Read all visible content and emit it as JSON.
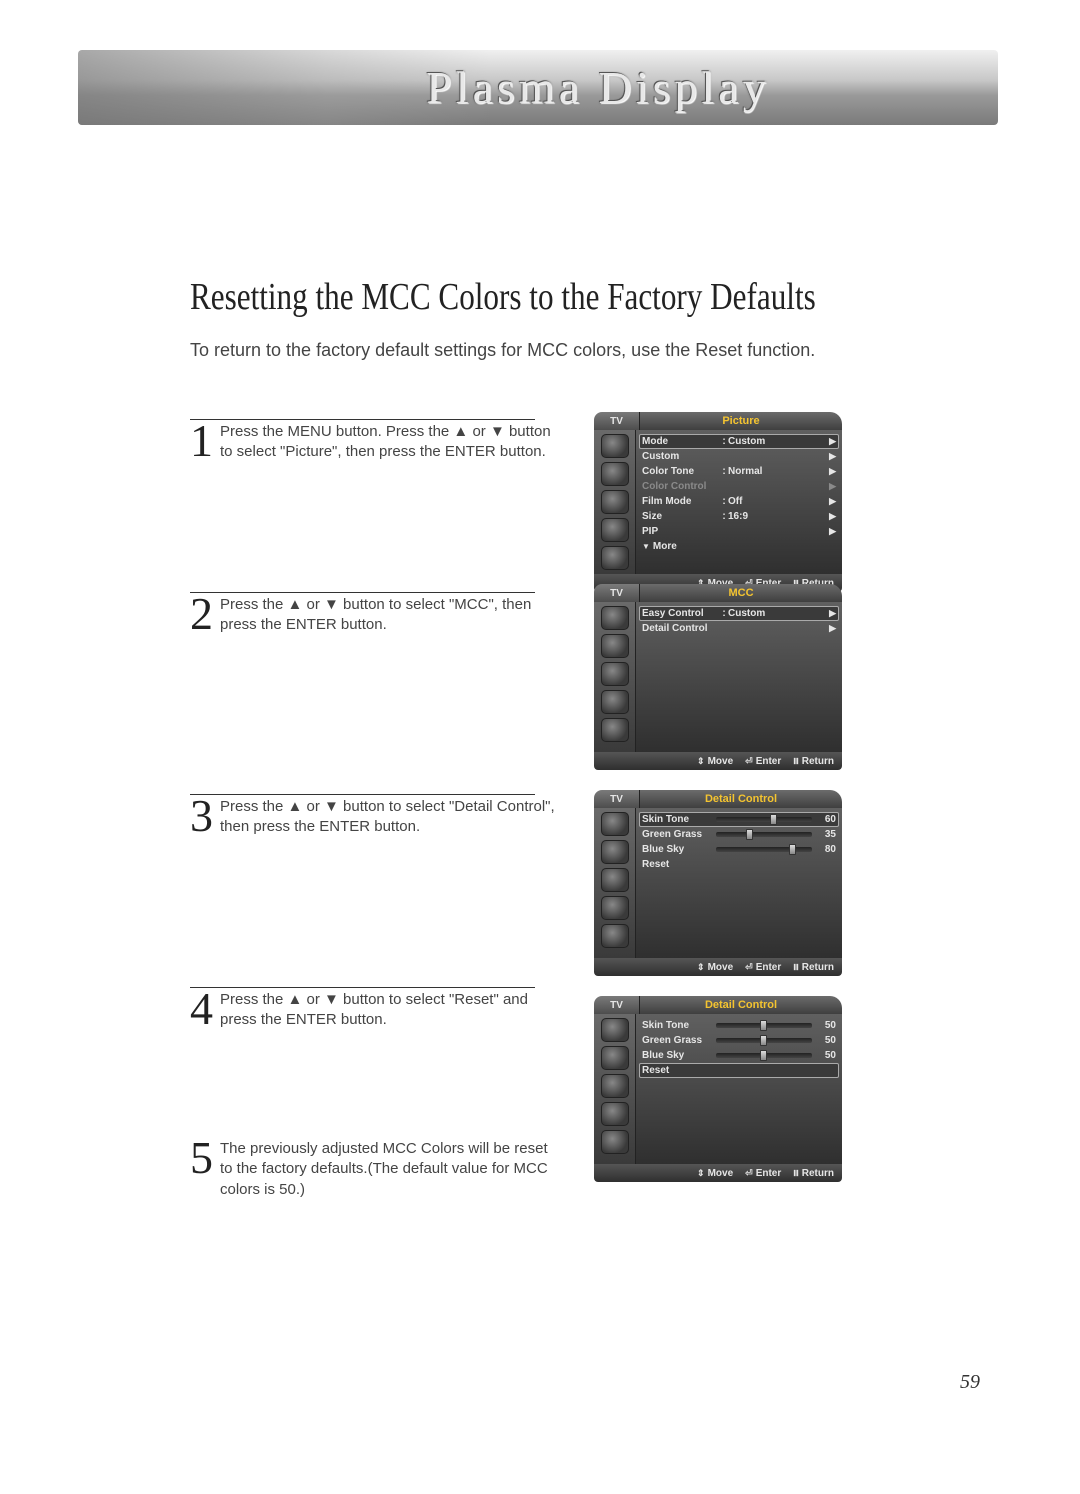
{
  "banner_title": "Plasma Display",
  "title": "Resetting the MCC Colors to the Factory Defaults",
  "intro": "To return to the factory default settings for MCC colors, use the Reset function.",
  "page_number": "59",
  "steps": {
    "1": "Press the MENU button. Press the ▲ or ▼ button to select \"Picture\", then press the ENTER button.",
    "2": "Press the ▲ or ▼ button to select \"MCC\", then press the ENTER button.",
    "3": "Press the ▲ or ▼ button to select \"Detail Control\", then press the ENTER button.",
    "4": "Press the ▲ or ▼ button to select \"Reset\" and press the ENTER button.",
    "5": "The previously adjusted MCC Colors will be reset to the factory defaults.(The default value for MCC colors is 50.)"
  },
  "osd_common": {
    "tv": "TV",
    "footer_move": "Move",
    "footer_enter": "Enter",
    "footer_return": "Return"
  },
  "osd1": {
    "title": "Picture",
    "rows": [
      {
        "label": "Mode",
        "value": "Custom",
        "selected": true,
        "arrow": true
      },
      {
        "label": "Custom",
        "value": "",
        "arrow": true
      },
      {
        "label": "Color Tone",
        "value": "Normal",
        "arrow": true
      },
      {
        "label": "Color Control",
        "value": "",
        "dim": true,
        "arrow": true
      },
      {
        "label": "Film Mode",
        "value": "Off",
        "arrow": true
      },
      {
        "label": "Size",
        "value": "16:9",
        "arrow": true
      },
      {
        "label": "PIP",
        "value": "",
        "arrow": true
      },
      {
        "label": "More",
        "value": "",
        "more": true
      }
    ]
  },
  "osd2": {
    "title": "MCC",
    "rows": [
      {
        "label": "Easy Control",
        "value": "Custom",
        "selected": true,
        "arrow": true
      },
      {
        "label": "Detail Control",
        "value": "",
        "arrow": true
      }
    ]
  },
  "osd3": {
    "title": "Detail Control",
    "sliders": [
      {
        "label": "Skin Tone",
        "value": 60,
        "selected": true
      },
      {
        "label": "Green Grass",
        "value": 35
      },
      {
        "label": "Blue Sky",
        "value": 80
      }
    ],
    "reset_label": "Reset"
  },
  "osd4": {
    "title": "Detail Control",
    "sliders": [
      {
        "label": "Skin Tone",
        "value": 50
      },
      {
        "label": "Green Grass",
        "value": 50
      },
      {
        "label": "Blue Sky",
        "value": 50
      }
    ],
    "reset_label": "Reset",
    "reset_selected": true
  }
}
